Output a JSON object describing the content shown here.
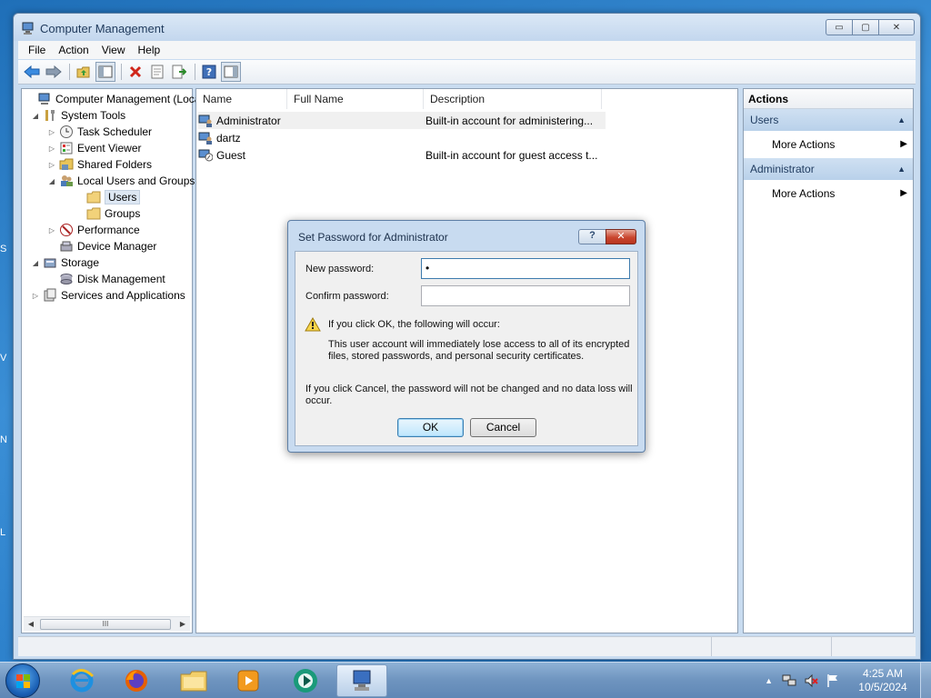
{
  "window": {
    "title": "Computer Management",
    "buttons": {
      "minimize": "▭",
      "maximize": "▢",
      "close": "✕"
    }
  },
  "menu": [
    "File",
    "Action",
    "View",
    "Help"
  ],
  "tree": {
    "root": "Computer Management (Local",
    "system_tools": "System Tools",
    "task_scheduler": "Task Scheduler",
    "event_viewer": "Event Viewer",
    "shared_folders": "Shared Folders",
    "local_users_groups": "Local Users and Groups",
    "users": "Users",
    "groups": "Groups",
    "performance": "Performance",
    "device_manager": "Device Manager",
    "storage": "Storage",
    "disk_management": "Disk Management",
    "services_apps": "Services and Applications",
    "scroll_thumb": "III"
  },
  "list": {
    "headers": [
      "Name",
      "Full Name",
      "Description"
    ],
    "rows": [
      {
        "name": "Administrator",
        "full_name": "",
        "description": "Built-in account for administering..."
      },
      {
        "name": "dartz",
        "full_name": "",
        "description": ""
      },
      {
        "name": "Guest",
        "full_name": "",
        "description": "Built-in account for guest access t..."
      }
    ]
  },
  "actions": {
    "title": "Actions",
    "section1": "Users",
    "more1": "More Actions",
    "section2": "Administrator",
    "more2": "More Actions"
  },
  "dialog": {
    "title": "Set Password for Administrator",
    "help": "?",
    "close": "✕",
    "new_password_label": "New password:",
    "new_password_value": "•",
    "confirm_password_label": "Confirm password:",
    "confirm_password_value": "",
    "warning_heading": "If you click OK, the following will occur:",
    "warning_line1": "This user account will immediately lose access to all of its encrypted",
    "warning_line2": "files, stored passwords, and personal security certificates.",
    "cancel_line1": "If you click Cancel, the password will not be changed and no data loss will",
    "cancel_line2": "occur.",
    "ok": "OK",
    "cancel": "Cancel"
  },
  "taskbar": {
    "apps": [
      "internet-explorer",
      "firefox",
      "file-explorer",
      "media-player",
      "browser-app",
      "computer-management"
    ],
    "time": "4:25 AM",
    "date": "10/5/2024"
  },
  "desktop_fragments": [
    "S",
    "V",
    "N",
    "L"
  ]
}
